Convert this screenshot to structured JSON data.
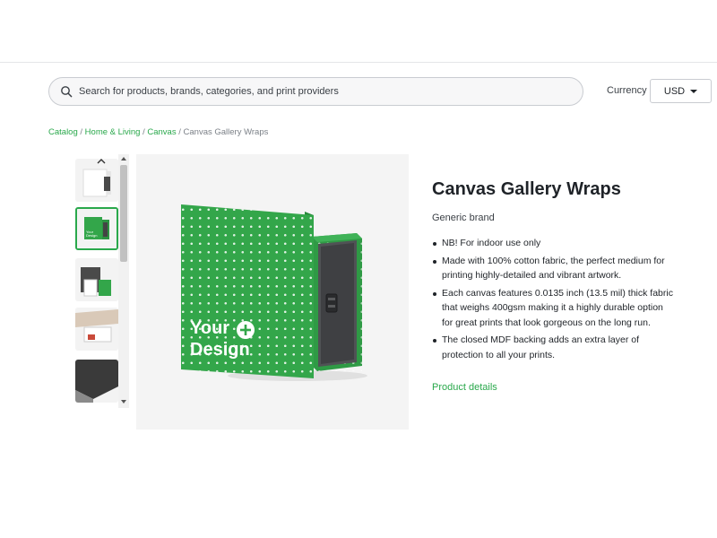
{
  "search": {
    "placeholder": "Search for products, brands, categories, and print providers"
  },
  "currency": {
    "label": "Currency",
    "selected": "USD"
  },
  "breadcrumb": {
    "items": [
      "Catalog",
      "Home & Living",
      "Canvas"
    ],
    "current": "Canvas Gallery Wraps",
    "separator": "/"
  },
  "product": {
    "title": "Canvas Gallery Wraps",
    "brand": "Generic brand",
    "features": [
      "NB! For indoor use only",
      "Made with 100% cotton fabric, the perfect medium for printing highly-detailed and vibrant artwork.",
      "Each canvas features 0.0135 inch (13.5 mil) thick fabric that weighs 400gsm making it a highly durable option for great prints that look gorgeous on the long run.",
      "The closed MDF backing adds an extra layer of protection to all your prints."
    ],
    "details_link": "Product details"
  },
  "main_image": {
    "line1": "Your",
    "line2": "Design",
    "icon": "plus-circle-icon"
  },
  "colors": {
    "accent": "#29a84b",
    "product_green": "#33a64a"
  }
}
